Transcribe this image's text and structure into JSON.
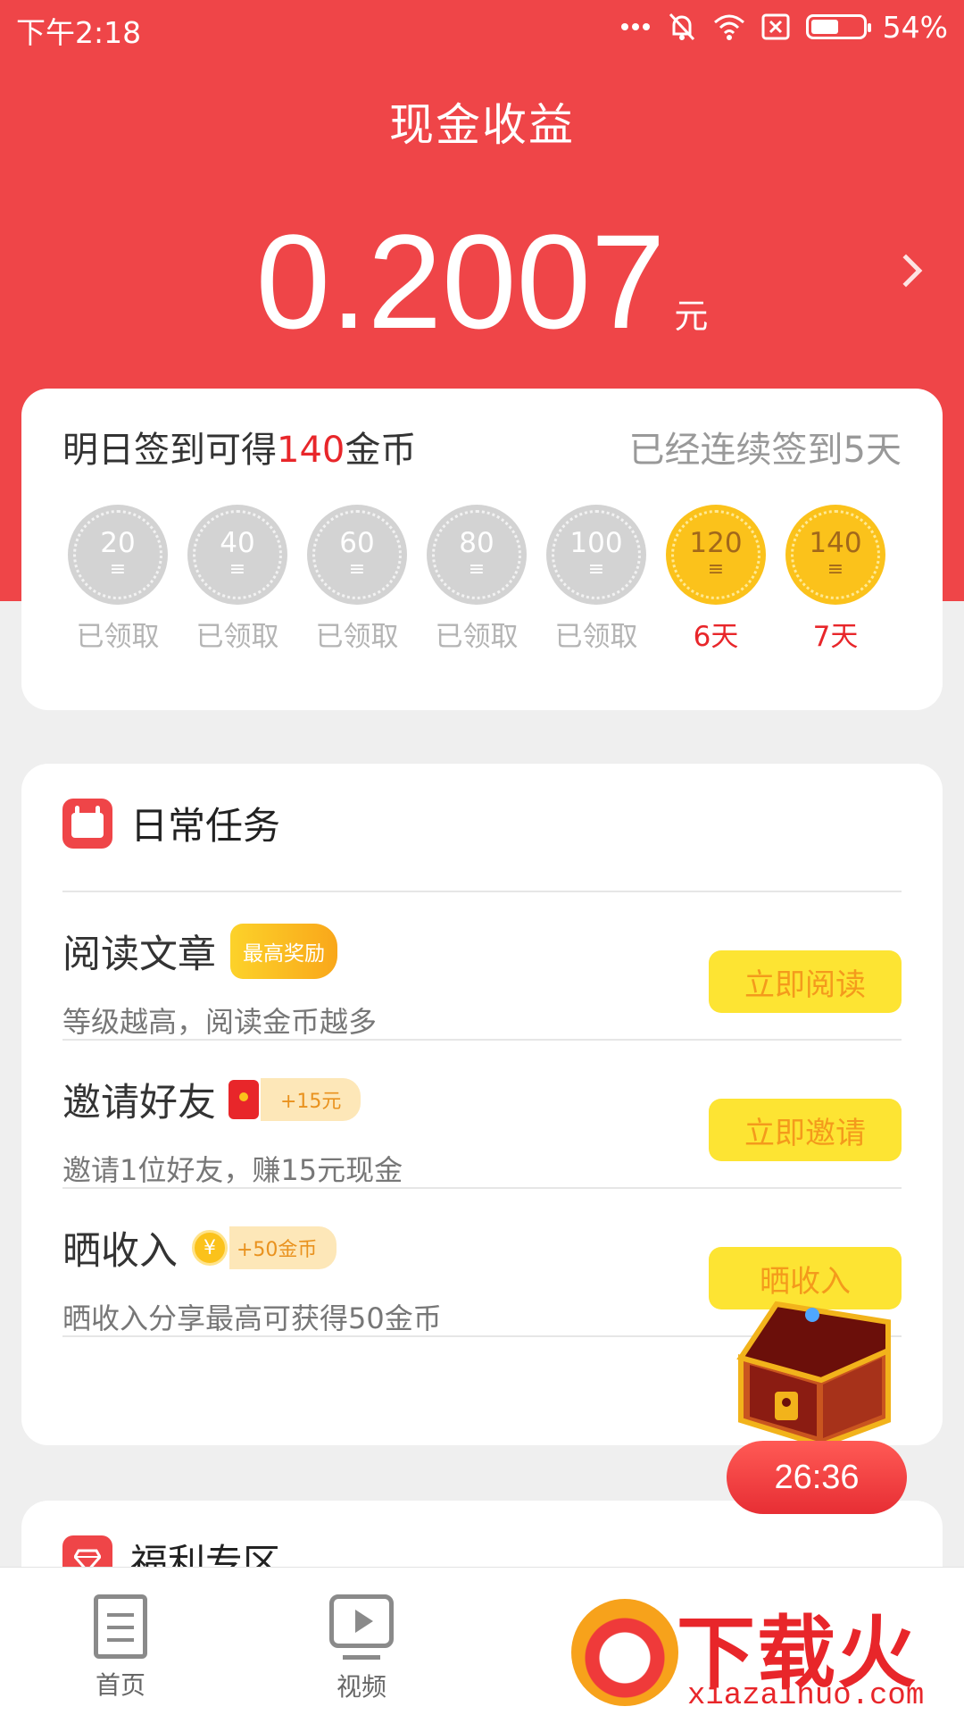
{
  "status_bar": {
    "time": "下午2:18",
    "battery": "54%",
    "battery_level": 0.54
  },
  "header": {
    "title": "现金收益",
    "balance": "0.2007",
    "unit": "元"
  },
  "signin": {
    "prefix": "明日签到可得",
    "amount": "140",
    "suffix": "金币",
    "streak_text": "已经连续签到5天",
    "days": [
      {
        "value": "20",
        "label": "已领取",
        "state": "claimed"
      },
      {
        "value": "40",
        "label": "已领取",
        "state": "claimed"
      },
      {
        "value": "60",
        "label": "已领取",
        "state": "claimed"
      },
      {
        "value": "80",
        "label": "已领取",
        "state": "claimed"
      },
      {
        "value": "100",
        "label": "已领取",
        "state": "claimed"
      },
      {
        "value": "120",
        "label": "6天",
        "state": "pending"
      },
      {
        "value": "140",
        "label": "7天",
        "state": "pending"
      }
    ]
  },
  "daily_tasks": {
    "title": "日常任务",
    "items": [
      {
        "title": "阅读文章",
        "badge": "最高奖励",
        "desc": "等级越高，阅读金币越多",
        "button": "立即阅读"
      },
      {
        "title": "邀请好友",
        "badge": "+15元",
        "desc": "邀请1位好友，赚15元现金",
        "button": "立即邀请"
      },
      {
        "title": "晒收入",
        "badge": "+50金币",
        "desc": "晒收入分享最高可获得50金币",
        "button": "晒收入"
      }
    ]
  },
  "welfare": {
    "title": "福利专区"
  },
  "floating": {
    "timer": "26:36"
  },
  "tab_bar": {
    "items": [
      {
        "label": "首页",
        "icon": "document-icon"
      },
      {
        "label": "视频",
        "icon": "video-icon"
      }
    ]
  },
  "watermark": {
    "text": "下载火",
    "url": "xiazaihuo.com"
  },
  "colors": {
    "brand_red": "#ef4548",
    "gold": "#fbc21b",
    "button_yellow": "#fde433"
  }
}
